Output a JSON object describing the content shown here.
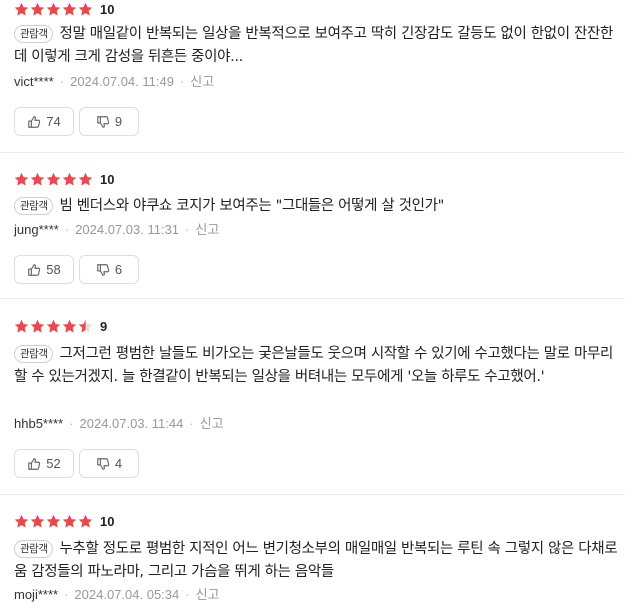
{
  "colors": {
    "star": "#f0464b",
    "star_empty": "#dedede",
    "muted": "#999999",
    "border": "#dedede"
  },
  "reviews": [
    {
      "rating": 5,
      "score": "10",
      "badge": "관람객",
      "text": "정말 매일같이 반복되는 일상을 반복적으로 보여주고 딱히 긴장감도 갈등도 없이 한없이 잔잔한데 이렇게 크게 감성을 뒤흔든 중이야...",
      "user": "vict****",
      "date": "2024.07.04. 11:49",
      "report": "신고",
      "likes": "74",
      "dislikes": "9"
    },
    {
      "rating": 5,
      "score": "10",
      "badge": "관람객",
      "text": "빔 벤더스와 야쿠쇼 코지가 보여주는 \"그대들은 어떻게 살 것인가\"",
      "user": "jung****",
      "date": "2024.07.03. 11:31",
      "report": "신고",
      "likes": "58",
      "dislikes": "6"
    },
    {
      "rating": 4.5,
      "score": "9",
      "badge": "관람객",
      "text": "그저그런 평범한 날들도 비가오는 궂은날들도 웃으며 시작할 수 있기에 수고했다는 말로 마무리 할 수 있는거겠지. 늘 한결같이 반복되는 일상을 버텨내는 모두에게 '오늘 하루도 수고했어.'",
      "user": "hhb5****",
      "date": "2024.07.03. 11:44",
      "report": "신고",
      "likes": "52",
      "dislikes": "4"
    },
    {
      "rating": 5,
      "score": "10",
      "badge": "관람객",
      "text": "누추할 정도로 평범한 지적인 어느 변기청소부의 매일매일 반복되는 루틴 속 그렇지 않은 다채로움 감정들의 파노라마, 그리고 가슴을 뛰게 하는 음악들",
      "user": "moji****",
      "date": "2024.07.04. 05:34",
      "report": "신고",
      "likes": "",
      "dislikes": ""
    }
  ]
}
